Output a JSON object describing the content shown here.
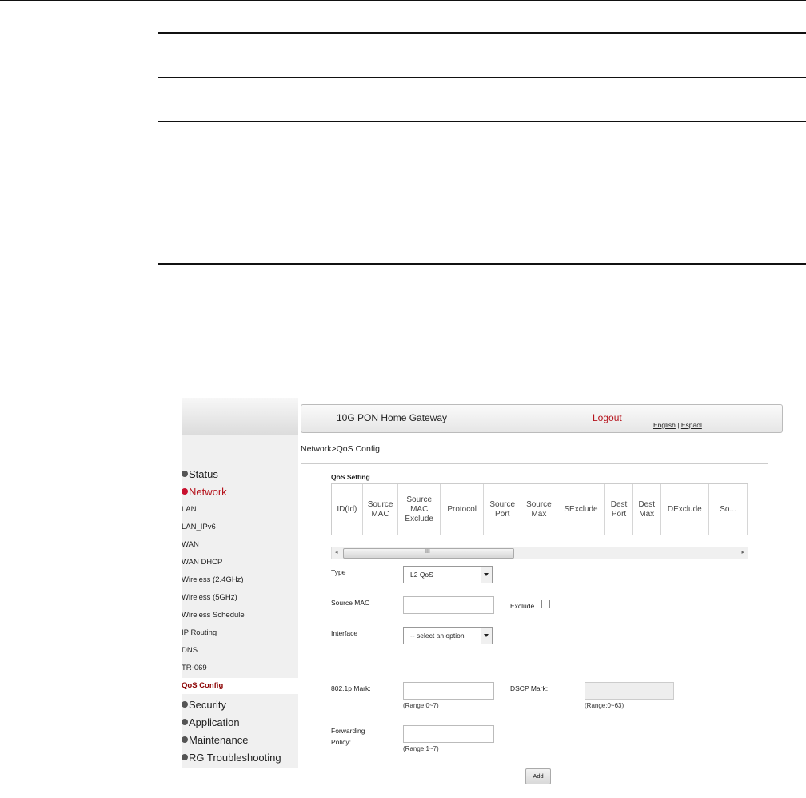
{
  "header": {
    "title": "10G PON Home Gateway",
    "logout": "Logout",
    "lang_english": "English",
    "lang_sep": "|",
    "lang_espanol": "Espaol"
  },
  "breadcrumb": "Network>QoS Config",
  "sidebar": {
    "top": [
      "Status",
      "Network"
    ],
    "network_items": [
      "LAN",
      "LAN_IPv6",
      "WAN",
      "WAN DHCP",
      "Wireless (2.4GHz)",
      "Wireless (5GHz)",
      "Wireless Schedule",
      "IP Routing",
      "DNS",
      "TR-069",
      "QoS Config"
    ],
    "bottom": [
      "Security",
      "Application",
      "Maintenance",
      "RG Troubleshooting"
    ]
  },
  "qos": {
    "section_title": "QoS Setting",
    "columns": [
      "ID(Id)",
      "Source MAC",
      "Source MAC Exclude",
      "Protocol",
      "Source Port",
      "Source Max",
      "SExclude",
      "Dest Port",
      "Dest Max",
      "DExclude",
      "So..."
    ]
  },
  "form": {
    "type_label": "Type",
    "type_value": "L2 QoS",
    "source_mac_label": "Source MAC",
    "source_mac_value": "",
    "exclude_label": "Exclude",
    "interface_label": "Interface",
    "interface_value": "-- select an option",
    "p8021_label": "802.1p Mark:",
    "p8021_value": "",
    "p8021_range": "(Range:0~7)",
    "dscp_label": "DSCP Mark:",
    "dscp_value": "",
    "dscp_range": "(Range:0~63)",
    "fwd_label1": "Forwarding",
    "fwd_label2": "Policy:",
    "fwd_value": "",
    "fwd_range": "(Range:1~7)",
    "add_button": "Add"
  },
  "colors": {
    "accent_red": "#b5121b",
    "active_nav": "#8b0000"
  }
}
